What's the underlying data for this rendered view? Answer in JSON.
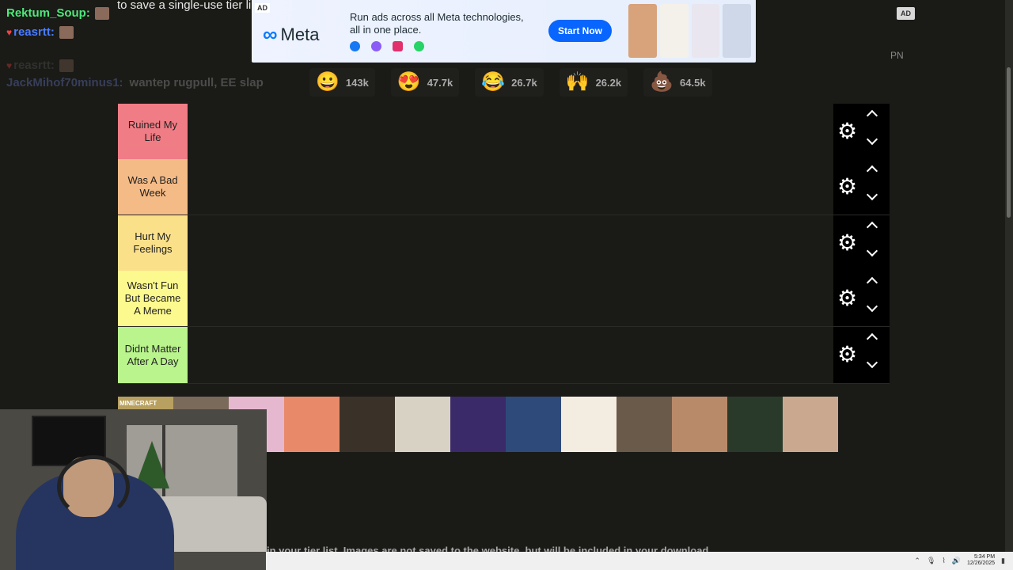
{
  "header": {
    "top_line": "to save a single-use tier li"
  },
  "chat": {
    "messages": [
      {
        "user": "Rektum_Soup:",
        "color": "#4ee87a",
        "text": ""
      },
      {
        "user": "reasrtt:",
        "color": "#4a7cff",
        "text": ""
      },
      {
        "user": "reasrtt:",
        "color": "#5a5a5a",
        "text": ""
      },
      {
        "user": "JackMihof70minus1:",
        "color": "#3d3d6a",
        "text": "wantep rugpull, EE slap"
      }
    ]
  },
  "ad": {
    "tag": "AD",
    "brand": "Meta",
    "headline_line1": "Run ads across all Meta technologies,",
    "headline_line2": "all in one place.",
    "cta": "Start Now",
    "side_badge": "AD",
    "pn": "PN",
    "colors": {
      "cta": "#0866ff",
      "logo": "#0a7cff"
    }
  },
  "reactions": [
    {
      "icon": "grin-emoji",
      "glyph": "😀",
      "count": "143k"
    },
    {
      "icon": "heart-eyes-emoji",
      "glyph": "😍",
      "count": "47.7k"
    },
    {
      "icon": "laughing-emoji",
      "glyph": "😂",
      "count": "26.7k"
    },
    {
      "icon": "raised-hands-emoji",
      "glyph": "🙌",
      "count": "26.2k"
    },
    {
      "icon": "poop-emoji",
      "glyph": "💩",
      "count": "64.5k"
    }
  ],
  "tiers": [
    {
      "label": "Ruined My Life",
      "color": "#f07c85"
    },
    {
      "label": "Was A Bad Week",
      "color": "#f5bb86"
    },
    {
      "label": "Hurt My Feelings",
      "color": "#fbe08a"
    },
    {
      "label": "Wasn't Fun But Became A Meme",
      "color": "#fcf98e"
    },
    {
      "label": "Didnt Matter After A Day",
      "color": "#b9f48c"
    }
  ],
  "pool": [
    {
      "caption": "MINECRAFT",
      "color": "#b8a060"
    },
    {
      "caption": "",
      "color": "#7a6a5a"
    },
    {
      "caption": "",
      "color": "#e6b8d0"
    },
    {
      "caption": "",
      "color": "#e88a6a"
    },
    {
      "caption": "",
      "color": "#3a3228"
    },
    {
      "caption": "",
      "color": "#d8d2c4"
    },
    {
      "caption": "",
      "color": "#3a2a6a"
    },
    {
      "caption": "",
      "color": "#2e4a7a"
    },
    {
      "caption": "",
      "color": "#f3ece0"
    },
    {
      "caption": "",
      "color": "#6a5a4a"
    },
    {
      "caption": "",
      "color": "#b88a6a"
    },
    {
      "caption": "",
      "color": "#2a3a2a"
    },
    {
      "caption": "",
      "color": "#caa890"
    }
  ],
  "footer": {
    "hint": "in your tier list. Images are not saved to the website, but will be included in your download."
  },
  "taskbar": {
    "time": "5:34 PM",
    "date": "12/26/2025"
  }
}
